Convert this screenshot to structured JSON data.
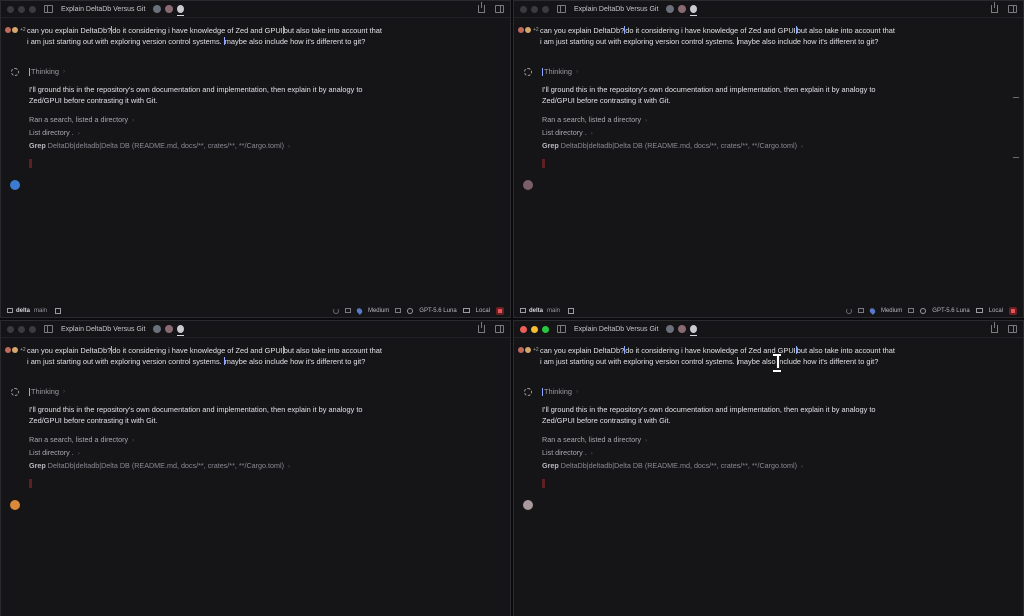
{
  "window": {
    "title": "Explain DeltaDb Versus Git"
  },
  "prompt": {
    "part1": "can you explain DeltaDb?",
    "part2": "do it considering i have knowledge of Zed and GPUI",
    "part3": "but also take into account that i am just starting out with exploring version control systems. ",
    "part4": "maybe also include how it's different to git?",
    "collaborator_count": "+2"
  },
  "thinking": {
    "label": "Thinking",
    "chevron": "›"
  },
  "answer": "I'll ground this in the repository's own documentation and implementation, then explain it by analogy to Zed/GPUI before contrasting it with Git.",
  "tools": {
    "search": "Ran a search, listed a directory",
    "list": "List directory .",
    "grep_label": "Grep",
    "grep_args": "DeltaDb|deltadb|Delta DB (README.md, docs/**, crates/**, **/Cargo.toml)",
    "chevron": "›"
  },
  "status": {
    "repo": "delta",
    "branch": "main",
    "effort": "Medium",
    "model": "GPT-5.6 Luna",
    "location": "Local"
  },
  "icons": {
    "titlebar_sidebar": "sidebar-toggle-icon",
    "share": "share-icon",
    "panel": "panel-toggle-icon",
    "thinking": "thinking-spinner-icon",
    "folder": "folder-icon",
    "new_thread": "new-thread-icon",
    "stop": "stop-icon"
  },
  "colors": {
    "background": "#151518",
    "stop": "#e05555",
    "caret": "#8fa8ff"
  }
}
